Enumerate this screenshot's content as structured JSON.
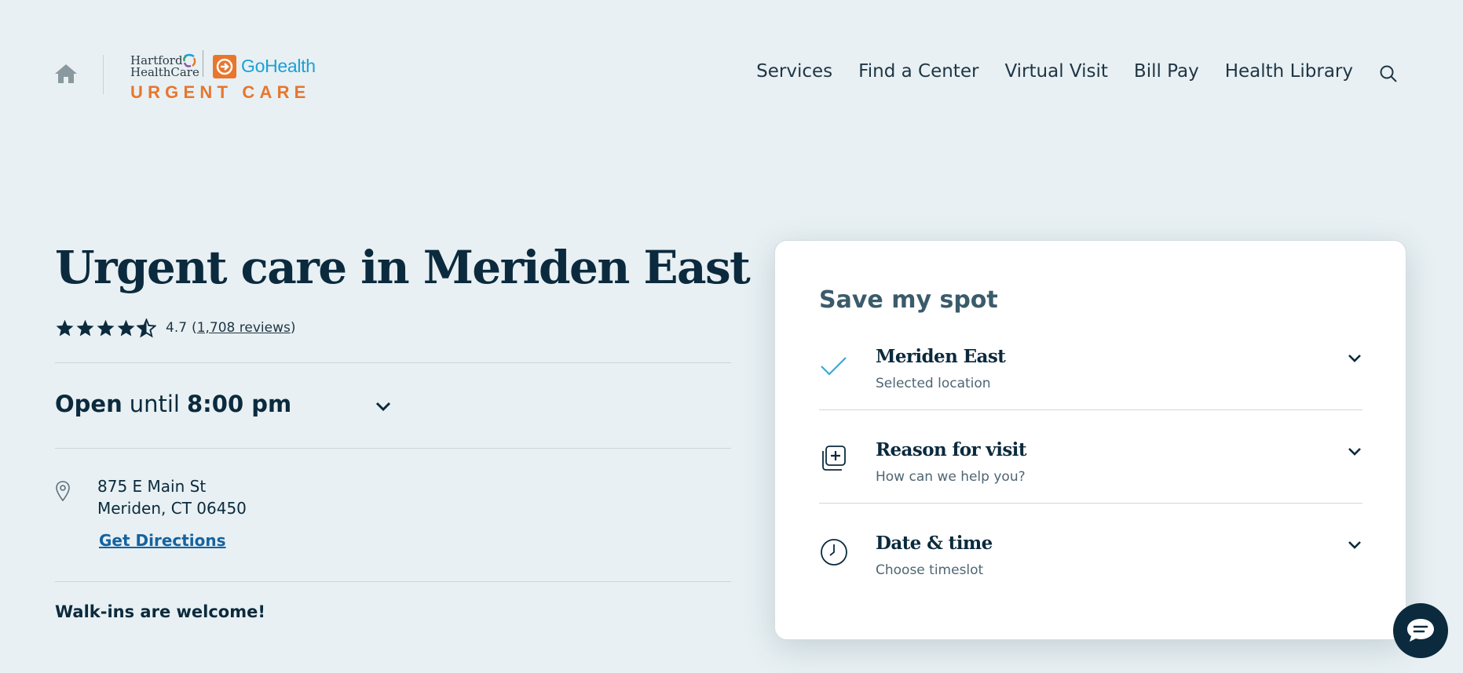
{
  "header": {
    "logo": {
      "hartford_line1": "Hartford",
      "hartford_line2": "HealthCare",
      "gohealth": "GoHealth",
      "urgent_care": "URGENT CARE"
    },
    "nav": [
      {
        "label": "Services"
      },
      {
        "label": "Find a Center"
      },
      {
        "label": "Virtual Visit"
      },
      {
        "label": "Bill Pay"
      },
      {
        "label": "Health Library"
      }
    ]
  },
  "location": {
    "title": "Urgent care in Meriden East",
    "rating": {
      "value": "4.7",
      "stars": 4.7,
      "open_paren": "(",
      "reviews": "1,708 reviews",
      "close_paren": ")"
    },
    "hours": {
      "status": "Open",
      "until": "until",
      "time": "8:00 pm"
    },
    "address": {
      "line1": "875 E Main St",
      "line2": "Meriden, CT 06450"
    },
    "directions_label": "Get Directions",
    "walkins": "Walk-ins are welcome!"
  },
  "booking": {
    "title": "Save my spot",
    "steps": [
      {
        "label": "Meriden East",
        "sub": "Selected location",
        "icon": "check-icon"
      },
      {
        "label": "Reason for visit",
        "sub": "How can we help you?",
        "icon": "medical-cross-icon"
      },
      {
        "label": "Date & time",
        "sub": "Choose timeslot",
        "icon": "clock-icon"
      }
    ]
  },
  "colors": {
    "background": "#e8f0f3",
    "navy": "#0b2a3d",
    "orange": "#e8762c",
    "blue": "#1ba0d7",
    "link": "#1463a0",
    "check": "#3aa8d8"
  }
}
